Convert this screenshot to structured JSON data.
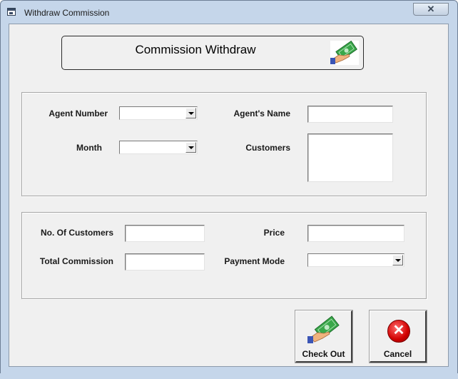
{
  "window": {
    "title": "Withdraw Commission",
    "close_glyph": "✕"
  },
  "header": {
    "title": "Commission Withdraw",
    "icon": "cash-hand-icon"
  },
  "agent_section": {
    "agent_number_label": "Agent Number",
    "agent_number_value": "",
    "month_label": "Month",
    "month_value": "",
    "agent_name_label": "Agent's Name",
    "agent_name_value": "",
    "customers_label": "Customers",
    "customers_value": ""
  },
  "commission_section": {
    "no_customers_label": "No. Of Customers",
    "no_customers_value": "",
    "total_commission_label": "Total Commission",
    "total_commission_value": "",
    "price_label": "Price",
    "price_value": "",
    "payment_mode_label": "Payment Mode",
    "payment_mode_value": ""
  },
  "buttons": {
    "checkout_label": "Check Out",
    "checkout_icon": "cash-hand-icon",
    "cancel_label": "Cancel",
    "cancel_icon": "red-x-circle-icon",
    "cancel_glyph": "✕"
  },
  "colors": {
    "frame": "#c5d6ea",
    "client": "#f0f0f0",
    "cancel_red": "#d10000",
    "cash_green": "#3aa84a"
  }
}
